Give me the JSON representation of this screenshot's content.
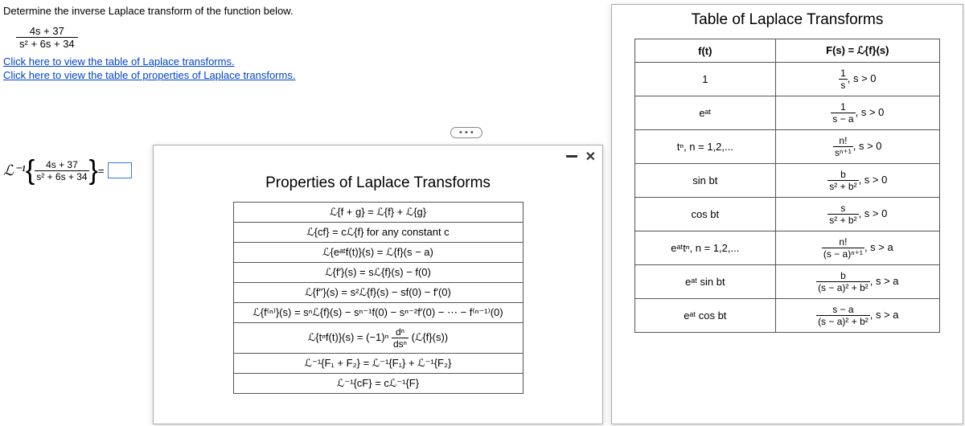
{
  "problem": {
    "instruction": "Determine the inverse Laplace transform of the function below.",
    "frac_num": "4s + 37",
    "frac_den": "s² + 6s + 34",
    "link1": "Click here to view the table of Laplace transforms.",
    "link2": "Click here to view the table of properties of Laplace transforms.",
    "dots": "• • •",
    "inv_prefix": "ℒ⁻¹",
    "ans_num": "4s + 37",
    "ans_den": "s² + 6s + 34",
    "equals": " = "
  },
  "props_modal": {
    "title": "Properties of Laplace Transforms",
    "rows": [
      "ℒ{f + g} = ℒ{f} + ℒ{g}",
      "ℒ{cf} = cℒ{f} for any constant c",
      "ℒ{eᵃᵗf(t)}(s) = ℒ{f}(s − a)",
      "ℒ{f′}(s) = sℒ{f}(s) − f(0)",
      "ℒ{f′′}(s) = s²ℒ{f}(s) − sf(0) − f′(0)",
      "ℒ{f⁽ⁿ⁾}(s) = sⁿℒ{f}(s) − sⁿ⁻¹f(0) − sⁿ⁻²f′(0) − ⋯ − f⁽ⁿ⁻¹⁾(0)",
      "ℒ{tⁿf(t)}(s) = (−1)ⁿ (dⁿ/dsⁿ)(ℒ{f}(s))",
      "ℒ⁻¹{F₁ + F₂} = ℒ⁻¹{F₁} + ℒ⁻¹{F₂}",
      "ℒ⁻¹{cF} = cℒ⁻¹{F}"
    ]
  },
  "table_modal": {
    "title": "Table of Laplace Transforms",
    "head_ft": "f(t)",
    "head_Fs": "F(s) = ℒ{f}(s)",
    "rows": [
      {
        "ft": "1",
        "Fs": "1/s , s > 0",
        "num": "1",
        "den": "s",
        "cond": ", s > 0"
      },
      {
        "ft": "eᵃᵗ",
        "num": "1",
        "den": "s − a",
        "cond": ", s > 0"
      },
      {
        "ft": "tⁿ, n = 1,2,...",
        "num": "n!",
        "den": "sⁿ⁺¹",
        "cond": ", s > 0"
      },
      {
        "ft": "sin bt",
        "num": "b",
        "den": "s² + b²",
        "cond": ", s > 0"
      },
      {
        "ft": "cos bt",
        "num": "s",
        "den": "s² + b²",
        "cond": ", s > 0"
      },
      {
        "ft": "eᵃᵗtⁿ, n = 1,2,...",
        "num": "n!",
        "den": "(s − a)ⁿ⁺¹",
        "cond": ", s > a"
      },
      {
        "ft": "eᵃᵗ sin bt",
        "num": "b",
        "den": "(s − a)² + b²",
        "cond": ", s > a"
      },
      {
        "ft": "eᵃᵗ cos bt",
        "num": "s − a",
        "den": "(s − a)² + b²",
        "cond": ", s > a"
      }
    ]
  }
}
